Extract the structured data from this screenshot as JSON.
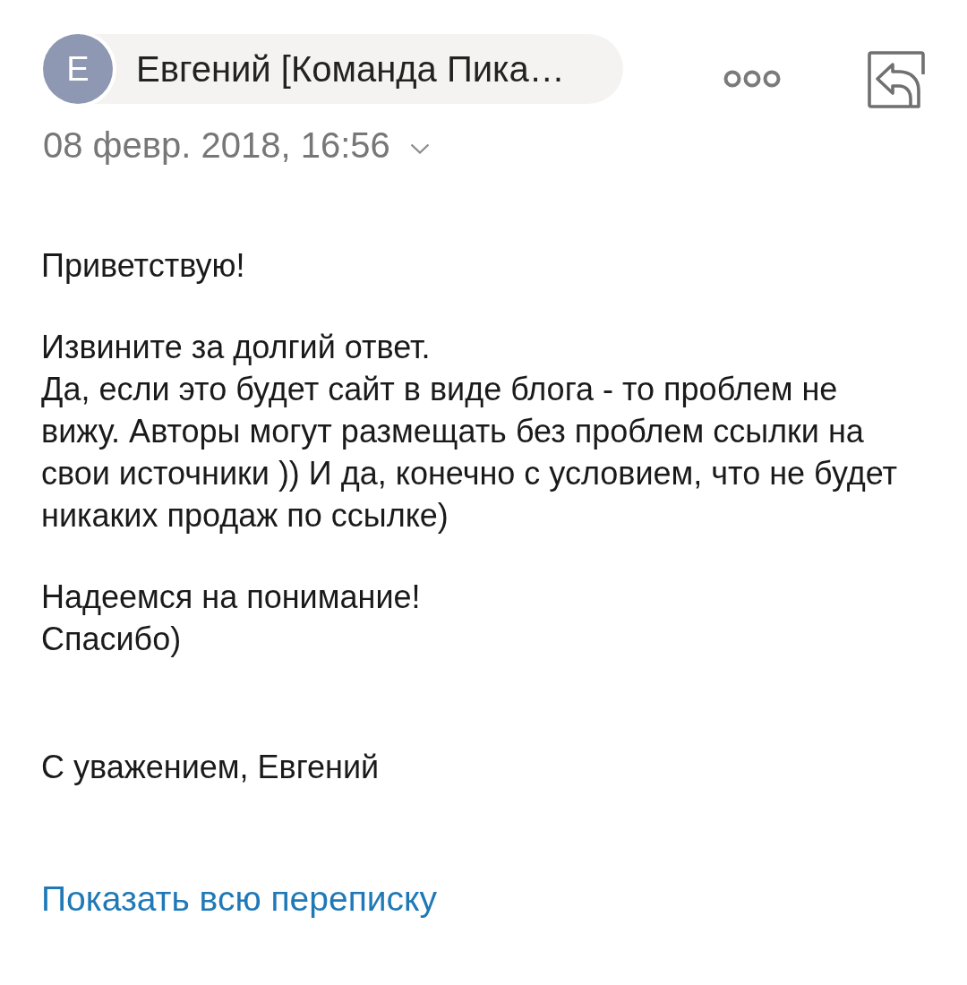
{
  "header": {
    "sender": {
      "initial": "Е",
      "name": "Евгений [Команда Пика…"
    },
    "date": "08 февр. 2018, 16:56"
  },
  "body": {
    "paragraphs": [
      [
        "Приветствую!"
      ],
      [
        "Извините за долгий ответ.",
        "Да, если это будет сайт в виде блога - то проблем не вижу. Авторы могут размещать без проблем ссылки на свои источники )) И да, конечно с условием, что не будет никаких продаж по ссылке)"
      ],
      [
        "Надеемся на понимание!",
        "Спасибо)"
      ]
    ],
    "signature": "С уважением, Евгений"
  },
  "thread_link": "Показать всю переписку"
}
